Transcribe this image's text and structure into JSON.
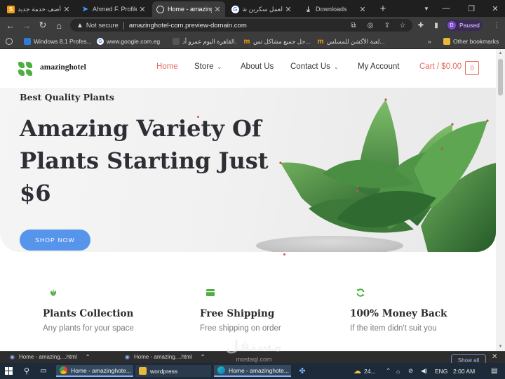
{
  "browser": {
    "tabs": [
      {
        "title": "أضف خدمة جديدة",
        "favicon": "mostaql-icon",
        "favicon_color": "#f39c12"
      },
      {
        "title": "Ahmed F. Profile",
        "favicon": "upwork-bird-icon",
        "favicon_color": "#3aa0ff"
      },
      {
        "title": "Home - amazing",
        "favicon": "globe-icon",
        "favicon_color": "#dddddd"
      },
      {
        "title": "لعمل سكرين شو",
        "favicon": "google-icon",
        "favicon_color": "#4285f4"
      },
      {
        "title": "Downloads",
        "favicon": "download-icon",
        "favicon_color": "#dddddd"
      }
    ],
    "active_tab_index": 2,
    "address": {
      "security_label": "Not secure",
      "url": "amazinghotel-com.preview-domain.com"
    },
    "profile": {
      "initial": "D",
      "label": "Paused"
    },
    "bookmarks": [
      {
        "label": "Windows 8.1 Profes...",
        "favicon": "bookmark-icon"
      },
      {
        "label": "www.google.com.eg",
        "favicon": "google-icon"
      },
      {
        "label": "القاهرة اليوم عمرو أد...",
        "favicon": "tv-icon"
      },
      {
        "label": "حل جميع مشاكل تس...",
        "favicon": "mostaql-icon"
      },
      {
        "label": "لعبة الأكشن للمسلس...",
        "favicon": "mostaql-icon"
      }
    ],
    "other_bookmarks": "Other bookmarks"
  },
  "site": {
    "brand": "amazinghotel",
    "nav": [
      {
        "label": "Home",
        "active": true,
        "has_dropdown": false
      },
      {
        "label": "Store",
        "active": false,
        "has_dropdown": true
      },
      {
        "label": "About Us",
        "active": false,
        "has_dropdown": false
      },
      {
        "label": "Contact Us",
        "active": false,
        "has_dropdown": true
      },
      {
        "label": "My Account",
        "active": false,
        "has_dropdown": false
      }
    ],
    "cart": {
      "label": "Cart / $0.00",
      "count": "0"
    },
    "hero": {
      "subtitle": "Best Quality Plants",
      "title_lines": [
        "Amazing Variety Of",
        "Plants Starting Just",
        "$6"
      ],
      "cta": "SHOP NOW"
    },
    "features": [
      {
        "icon": "leaf-icon",
        "title": "Plants Collection",
        "desc": "Any plants for your space"
      },
      {
        "icon": "truck-icon",
        "title": "Free Shipping",
        "desc": "Free shipping on order"
      },
      {
        "icon": "refresh-icon",
        "title": "100% Money Back",
        "desc": "If the item didn't suit you"
      }
    ],
    "colors": {
      "accent": "#e36a5c",
      "button": "#5795ec",
      "green": "#4caf3f"
    }
  },
  "downloads": {
    "items": [
      "Home - amazing....html",
      "Home - amazing....html"
    ],
    "show_all": "Show all"
  },
  "watermark": {
    "arabic": "مستقل",
    "latin": "mostaql.com"
  },
  "taskbar": {
    "apps": [
      {
        "label": "Home - amazinghote...",
        "icon": "chrome-icon"
      },
      {
        "label": "wordpress",
        "icon": "folder-icon"
      },
      {
        "label": "Home - amazinghote...",
        "icon": "edge-icon"
      }
    ],
    "weather": "24...",
    "language": "ENG",
    "time": "2:00 AM"
  }
}
